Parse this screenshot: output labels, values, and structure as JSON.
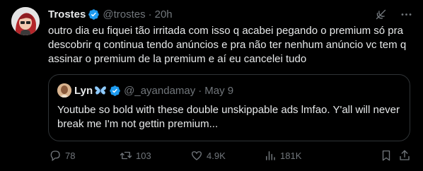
{
  "tweet": {
    "author_name": "Trostes",
    "handle": "@trostes",
    "separator": "·",
    "time": "20h",
    "text": "outro dia eu fiquei tão irritada com isso q acabei pegando o premium só pra descobrir q continua tendo anúncios e pra não ter nenhum anúncio vc tem q assinar o premium de la premium e aí eu cancelei tudo"
  },
  "quote": {
    "author_name": "Lyn",
    "handle": "@_ayandamay",
    "separator": "·",
    "time": "May 9",
    "text": "Youtube so bold with these double unskippable ads lmfao. Y'all will never break me I'm not gettin premium..."
  },
  "actions": {
    "replies": "78",
    "reposts": "103",
    "likes": "4.9K",
    "views": "181K"
  },
  "colors": {
    "background": "#000000",
    "text_primary": "#e7e9ea",
    "text_secondary": "#71767b",
    "verified_blue": "#1d9bf0",
    "border": "#2f3336",
    "butterfly": "#8ecbff"
  },
  "icons": {
    "verified": "verified-badge-icon",
    "grok": "grok-icon",
    "more": "more-icon",
    "reply": "reply-icon",
    "repost": "repost-icon",
    "like": "like-icon",
    "views": "views-icon",
    "bookmark": "bookmark-icon",
    "share": "share-icon",
    "butterfly": "butterfly-emoji"
  }
}
